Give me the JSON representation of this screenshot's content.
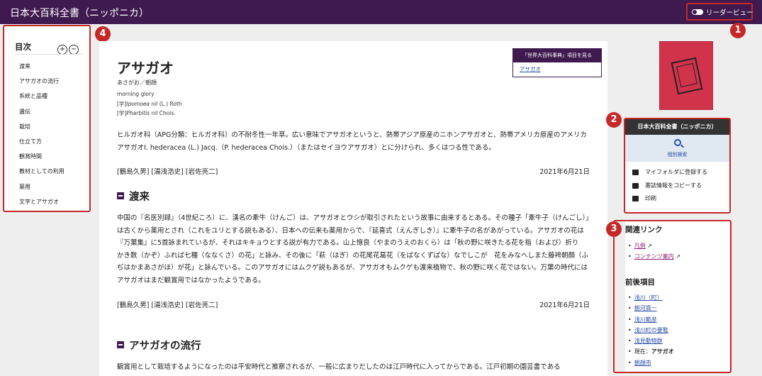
{
  "header": {
    "title": "日本大百科全書（ニッポニカ）",
    "reader_view": "リーダービュー"
  },
  "badges": [
    "1",
    "2",
    "3",
    "4"
  ],
  "toc": {
    "heading": "目次",
    "expand": "+",
    "collapse": "−",
    "items": [
      "渡来",
      "アサガオの流行",
      "系統と品種",
      "遺伝",
      "栽培",
      "仕立て方",
      "観賞時間",
      "教材としての利用",
      "薬用",
      "文字とアサガオ"
    ]
  },
  "article": {
    "title": "アサガオ",
    "reading": "あさがお／朝顔",
    "english": "morning glory",
    "sci1_prefix": "[学]",
    "sci1_italic": "Ipomoea nil",
    "sci1_rest": " (L.) Roth",
    "sci2_prefix": "[学]",
    "sci2_italic": "Pharbitis nil",
    "sci2_rest": " Chois.",
    "sekai_head": "「世界大百科事典」項目を見る",
    "sekai_link": "アサガオ",
    "intro": "ヒルガオ科（APG分類：ヒルガオ科）の不耐冬性一年草。広い意味でアサガオというと、熱帯アジア原産のニホンアサガオと、熱帯アメリカ原産のアメリカアサガオI. hederacea (L.) Jacq.（P. hederacea Chois.）（またはセイヨウアサガオ）とに分けられ、多くはつる性である。",
    "authors1": "[鶴島久男] [湯浅浩史] [岩佐亮二]",
    "date1": "2021年6月21日",
    "section1": "渡来",
    "para1": "中国の『名医別録』（4世紀ころ）に、漢名の牽牛（けんご）は、アサガオとウシが取引されたという故事に由来するとある。その種子「牽牛子（けんごし）」は古くから薬用とされ（これをユリとする説もある）、日本への伝来も薬用からで、『延喜式（えんぎしき）』に牽牛子の名があがっている。アサガオの花は『万葉集』に5首詠まれているが、それはキキョウとする説が有力である。山上憶良（やまのうえのおくら）は「秋の野に咲きたる花を指（および）折り　かき数（かぞ）ふれば七種（ななくさ）の花」と詠み、その後に「萩（はぎ）の花尾花葛花（をばなくずばな）なでしこが　花をみなへしまた藤袴朝顔（ふぢはかまあさがほ）が花」と詠んでいる。このアサガオにはムクゲ説もあるが、アサガオもムクゲも渡来植物で、秋の野に咲く花ではない。万葉の時代にはアサガオはまだ観賞用ではなかったようである。",
    "authors2": "[鶴島久男] [湯浅浩史] [岩佐亮二]",
    "date2": "2021年6月21日",
    "section2": "アサガオの流行",
    "para2": "観賞用として栽培するようになったのは平安時代と推察されるが、一般に広まりだしたのは江戸時代に入ってからである。江戸初期の園芸書である"
  },
  "panel": {
    "heading": "日本大百科全書（ニッポニカ）",
    "search": "個別検索",
    "actions": [
      "マイフォルダに登録する",
      "書誌情報をコピーする",
      "印刷"
    ]
  },
  "links": {
    "related_heading": "関連リンク",
    "related": [
      "凡例",
      "コンテンツ案内"
    ],
    "adjacent_heading": "前後項目",
    "adjacent": [
      "浅川（町）",
      "朝河貫一",
      "浅川範彦",
      "浅川町の要覧",
      "浅見動物群"
    ],
    "current_prefix": "現在：",
    "current": "アサガオ",
    "next": "朝顔市"
  }
}
